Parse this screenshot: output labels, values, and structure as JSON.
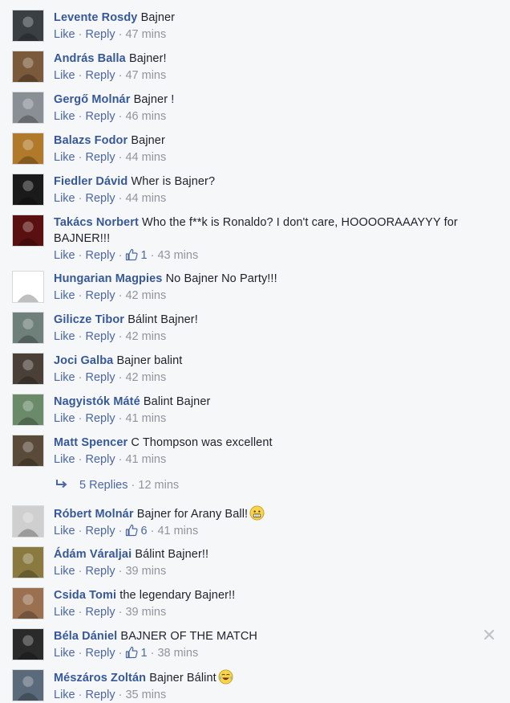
{
  "actions": {
    "like": "Like",
    "reply": "Reply",
    "sep": "·"
  },
  "comments": [
    {
      "author": "Levente Rosdy",
      "text": "Bajner",
      "time": "47 mins",
      "likes": "",
      "avatar": "#3a3f44"
    },
    {
      "author": "András Balla",
      "text": "Bajner!",
      "time": "47 mins",
      "likes": "",
      "avatar": "#7a5a3a"
    },
    {
      "author": "Gergő Molnár",
      "text": "Bajner !",
      "time": "46 mins",
      "likes": "",
      "avatar": "#8a8f96"
    },
    {
      "author": "Balazs Fodor",
      "text": "Bajner",
      "time": "44 mins",
      "likes": "",
      "avatar": "#b07a2a"
    },
    {
      "author": "Fiedler Dávid",
      "text": "Wher is Bajner?",
      "time": "44 mins",
      "likes": "",
      "avatar": "#1a1a1a"
    },
    {
      "author": "Takács Norbert",
      "text": "Who the f**k is Ronaldo? I don't care, HOOOORAAAYYY for BAJNER!!!",
      "time": "43 mins",
      "likes": "1",
      "avatar": "#5a1010"
    },
    {
      "author": "Hungarian Magpies",
      "text": "No Bajner No Party!!!",
      "time": "42 mins",
      "likes": "",
      "avatar": "#ffffff"
    },
    {
      "author": "Gilicze Tibor",
      "text": "Bálint Bajner!",
      "time": "42 mins",
      "likes": "",
      "avatar": "#6f7f7a"
    },
    {
      "author": "Joci Galba",
      "text": "Bajner balint",
      "time": "42 mins",
      "likes": "",
      "avatar": "#4a4038"
    },
    {
      "author": "Nagyistók Máté",
      "text": "Balint Bajner",
      "time": "41 mins",
      "likes": "",
      "avatar": "#6a8a6a"
    },
    {
      "author": "Matt Spencer",
      "text": "C Thompson was excellent",
      "time": "41 mins",
      "likes": "",
      "avatar": "#5a4a3a"
    },
    {
      "author": "Róbert Molnár",
      "text": "Bajner for Arany Ball!",
      "time": "41 mins",
      "likes": "6",
      "emoji": "grin-emoji",
      "avatar": "#cfcfcf"
    },
    {
      "author": "Ádám Váraljai",
      "text": "Bálint Bajner!!",
      "time": "39 mins",
      "likes": "",
      "avatar": "#8a7a40"
    },
    {
      "author": "Csida Tomi",
      "text": "the legendary Bajner!!",
      "time": "39 mins",
      "likes": "",
      "avatar": "#9a7050"
    },
    {
      "author": "Béla Dániel",
      "text": "BAJNER OF THE MATCH",
      "time": "38 mins",
      "likes": "1",
      "avatar": "#2a2a2a"
    },
    {
      "author": "Mészáros Zoltán",
      "text": "Bajner Bálint",
      "time": "35 mins",
      "likes": "",
      "emoji": "laugh-cry-emoji",
      "avatar": "#5a6a7a"
    }
  ],
  "replies": {
    "label": "5 Replies",
    "time": "12 mins"
  },
  "colors": {
    "author": "#365899",
    "link": "#4b67a1",
    "meta": "#90949c",
    "background": "#f6f7f9"
  }
}
